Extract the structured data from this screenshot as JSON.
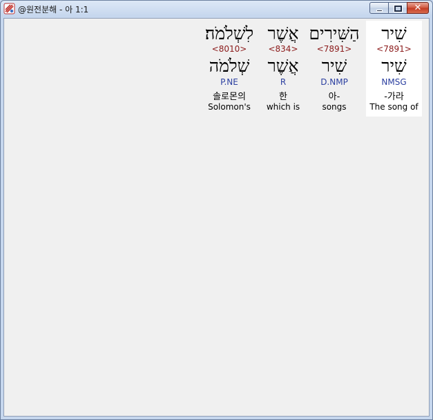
{
  "window": {
    "title": "@원전분해 - 아 1:1",
    "buttons": {
      "minimize": "minimize",
      "maximize": "maximize",
      "close": "close"
    },
    "close_label": "✕"
  },
  "colors": {
    "strong": "#8b1a1a",
    "morph": "#2b3fa0",
    "selected_bg": "#ffffff"
  },
  "words": [
    {
      "form": "שִׁיר",
      "strong": "<7891>",
      "lemma": "שִׁיר",
      "morph": "NMSG",
      "korean": "-가라",
      "english": "The song of",
      "selected": true
    },
    {
      "form": "הַשִּׁירִים",
      "strong": "<7891>",
      "lemma": "שִׁיר",
      "morph": "D.NMP",
      "korean": "아-",
      "english": "songs",
      "selected": false
    },
    {
      "form": "אֲשֶׁר",
      "strong": "<834>",
      "lemma": "אֲשֶׁר",
      "morph": "R",
      "korean": "한",
      "english": "which is",
      "selected": false
    },
    {
      "form": "לִשְׁלֹמֹה׃",
      "strong": "<8010>",
      "lemma": "שְׁלֹמֹה",
      "morph": "P.NE",
      "korean": "솔로몬의",
      "english": "Solomon's",
      "selected": false
    }
  ]
}
